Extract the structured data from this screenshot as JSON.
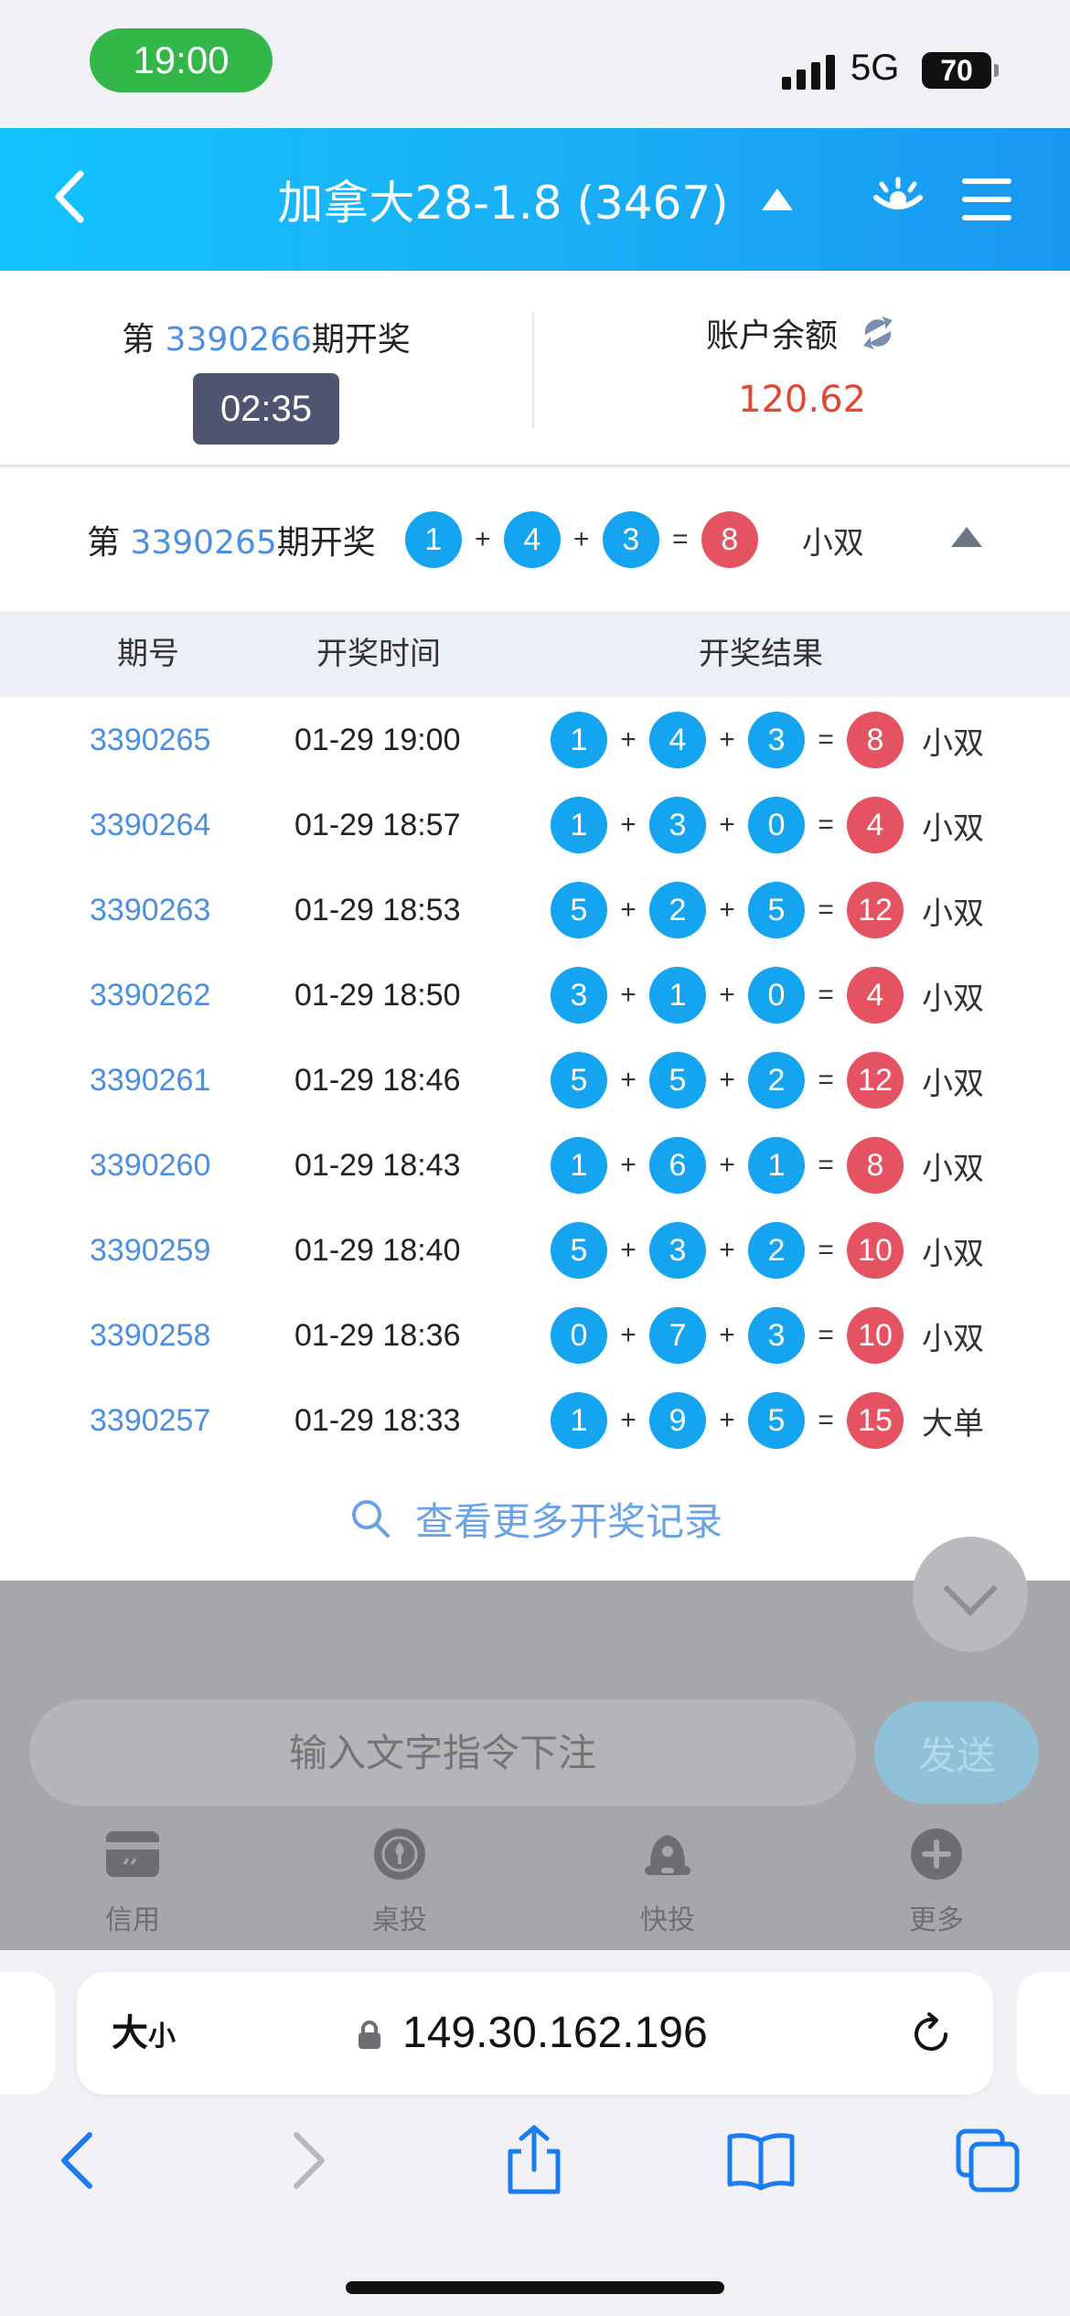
{
  "status_bar": {
    "time": "19:00",
    "network": "5G",
    "battery": "70"
  },
  "header": {
    "title": "加拿大28-1.8 (3467)"
  },
  "current": {
    "prefix": "第 ",
    "period": "3390266",
    "suffix": "期开奖",
    "countdown": "02:35",
    "balance_label": "账户余额",
    "balance": "120.62"
  },
  "last_draw": {
    "prefix": "第 ",
    "period": "3390265",
    "suffix": "期开奖",
    "n1": "1",
    "n2": "4",
    "n3": "3",
    "sum": "8",
    "type": "小双"
  },
  "table": {
    "headers": [
      "期号",
      "开奖时间",
      "开奖结果"
    ],
    "rows": [
      {
        "no": "3390265",
        "time": "01-29 19:00",
        "n1": "1",
        "n2": "4",
        "n3": "3",
        "sum": "8",
        "type": "小双"
      },
      {
        "no": "3390264",
        "time": "01-29 18:57",
        "n1": "1",
        "n2": "3",
        "n3": "0",
        "sum": "4",
        "type": "小双"
      },
      {
        "no": "3390263",
        "time": "01-29 18:53",
        "n1": "5",
        "n2": "2",
        "n3": "5",
        "sum": "12",
        "type": "小双"
      },
      {
        "no": "3390262",
        "time": "01-29 18:50",
        "n1": "3",
        "n2": "1",
        "n3": "0",
        "sum": "4",
        "type": "小双"
      },
      {
        "no": "3390261",
        "time": "01-29 18:46",
        "n1": "5",
        "n2": "5",
        "n3": "2",
        "sum": "12",
        "type": "小双"
      },
      {
        "no": "3390260",
        "time": "01-29 18:43",
        "n1": "1",
        "n2": "6",
        "n3": "1",
        "sum": "8",
        "type": "小双"
      },
      {
        "no": "3390259",
        "time": "01-29 18:40",
        "n1": "5",
        "n2": "3",
        "n3": "2",
        "sum": "10",
        "type": "小双"
      },
      {
        "no": "3390258",
        "time": "01-29 18:36",
        "n1": "0",
        "n2": "7",
        "n3": "3",
        "sum": "10",
        "type": "小双"
      },
      {
        "no": "3390257",
        "time": "01-29 18:33",
        "n1": "1",
        "n2": "9",
        "n3": "5",
        "sum": "15",
        "type": "大单"
      }
    ]
  },
  "more_label": "查看更多开奖记录",
  "command": {
    "placeholder": "输入文字指令下注",
    "send": "发送"
  },
  "tabs": [
    {
      "label": "信用"
    },
    {
      "label": "桌投"
    },
    {
      "label": "快投"
    },
    {
      "label": "更多"
    }
  ],
  "browser": {
    "aa_big": "大",
    "aa_small": "小",
    "url": "149.30.162.196"
  },
  "icons": [
    "back-icon",
    "caret-up-icon",
    "eye-icon",
    "menu-icon",
    "refresh-icon",
    "search-icon",
    "chevron-down-icon",
    "credit-icon",
    "table-bet-icon",
    "quick-bet-icon",
    "plus-icon",
    "lock-icon",
    "reload-icon",
    "share-icon",
    "bookmarks-icon",
    "tabs-icon"
  ],
  "colors": {
    "header_blue": "#14c3ff",
    "ball_blue": "#14a4f0",
    "ball_red": "#e55363",
    "link_blue": "#4c8fe0",
    "balance_red": "#e2482f"
  }
}
